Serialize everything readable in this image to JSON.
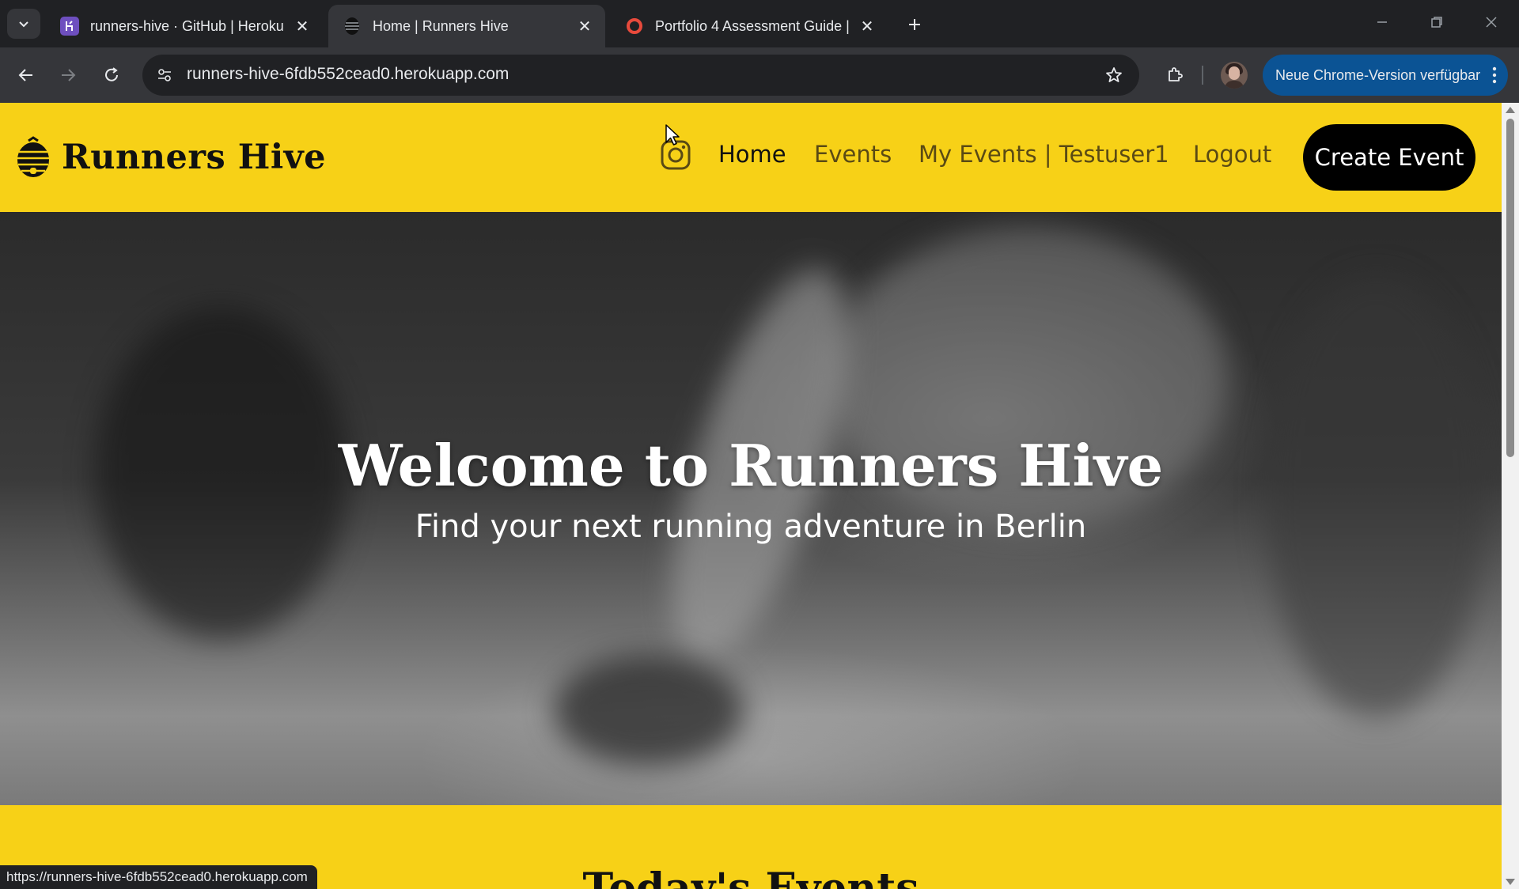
{
  "browser": {
    "tabs": [
      {
        "title": "runners-hive · GitHub | Heroku",
        "favicon": "heroku-icon",
        "active": false
      },
      {
        "title": "Home | Runners Hive",
        "favicon": "beehive-icon",
        "active": true
      },
      {
        "title": "Portfolio 4 Assessment Guide | ",
        "favicon": "lifebuoy-icon",
        "active": false
      }
    ],
    "url": "runners-hive-6fdb552cead0.herokuapp.com",
    "update_label": "Neue Chrome-Version verfügbar",
    "status_url": "https://runners-hive-6fdb552cead0.herokuapp.com"
  },
  "site": {
    "brand": "Runners Hive",
    "nav": {
      "instagram": "instagram-icon",
      "home": "Home",
      "events": "Events",
      "my_events": "My Events | Testuser1",
      "logout": "Logout",
      "create": "Create Event"
    },
    "hero": {
      "title": "Welcome to Runners Hive",
      "subtitle": "Find your next running adventure in Berlin"
    },
    "section_title": "Today's Events"
  },
  "colors": {
    "brand_yellow": "#f7d117",
    "cta_black": "#000000",
    "chrome_dark": "#202124",
    "chrome_toolbar": "#35363a",
    "update_blue": "#0b5394"
  }
}
